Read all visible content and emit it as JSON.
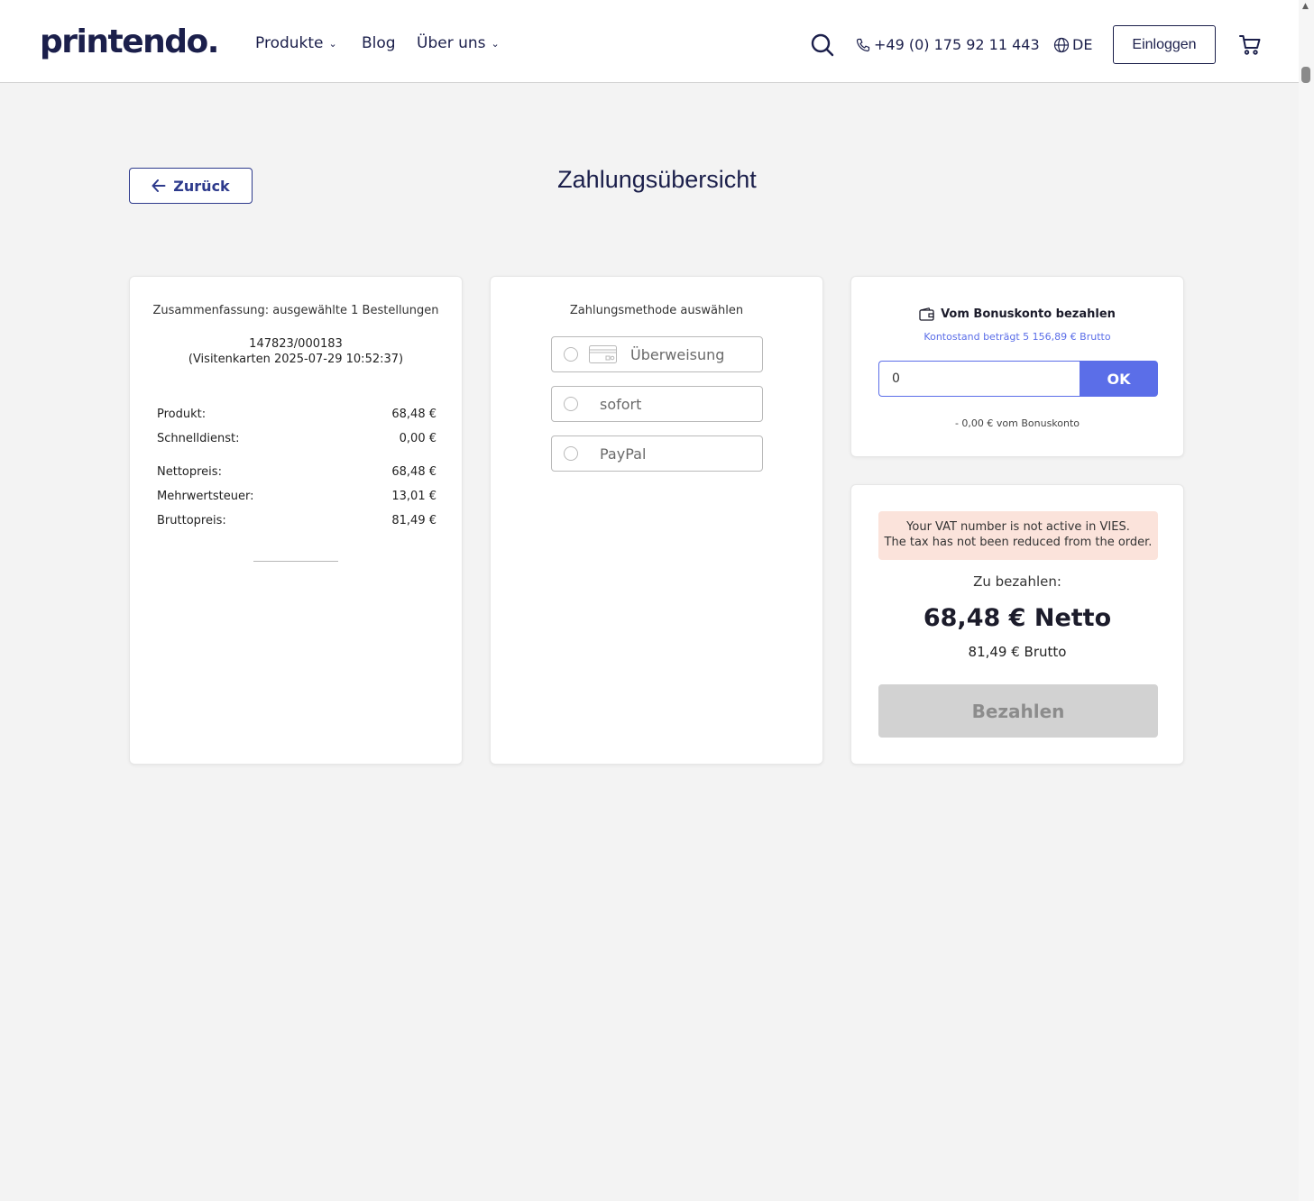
{
  "header": {
    "logo": "printendo.",
    "nav": [
      {
        "label": "Produkte",
        "dropdown": true
      },
      {
        "label": "Blog",
        "dropdown": false
      },
      {
        "label": "Über uns",
        "dropdown": true
      }
    ],
    "phone": "+49 (0) 175 92 11 443",
    "language": "DE",
    "login_label": "Einloggen"
  },
  "page": {
    "back_label": "Zurück",
    "title": "Zahlungsübersicht"
  },
  "summary": {
    "title": "Zusammenfassung: ausgewählte 1 Bestellungen",
    "order_id": "147823/000183",
    "order_desc": "(Visitenkarten 2025-07-29 10:52:37)",
    "rows": [
      {
        "label": "Produkt:",
        "value": "68,48 €"
      },
      {
        "label": "Schnelldienst:",
        "value": "0,00 €"
      },
      {
        "label": "Nettopreis:",
        "value": "68,48 €"
      },
      {
        "label": "Mehrwertsteuer:",
        "value": "13,01 €"
      },
      {
        "label": "Bruttopreis:",
        "value": "81,49 €"
      }
    ]
  },
  "payment_methods": {
    "title": "Zahlungsmethode auswählen",
    "options": [
      {
        "label": "Überweisung",
        "icon": "credit-card-icon"
      },
      {
        "label": "sofort",
        "icon": ""
      },
      {
        "label": "PayPal",
        "icon": ""
      }
    ]
  },
  "bonus": {
    "title": "Vom Bonuskonto bezahlen",
    "balance": "Kontostand beträgt 5 156,89 € Brutto",
    "input_value": "0",
    "ok_label": "OK",
    "deduction": "- 0,00 € vom Bonuskonto"
  },
  "total": {
    "vat_line1": "Your VAT number is not active in VIES.",
    "vat_line2": "The tax has not been reduced from the order.",
    "pay_label": "Zu bezahlen:",
    "netto": "68,48 € Netto",
    "brutto": "81,49 € Brutto",
    "pay_button": "Bezahlen"
  },
  "colors": {
    "brand": "#1b1f4b",
    "accent": "#5b6ee8",
    "alert_bg": "#fbe3db",
    "disabled_btn": "#d2d2d2"
  }
}
